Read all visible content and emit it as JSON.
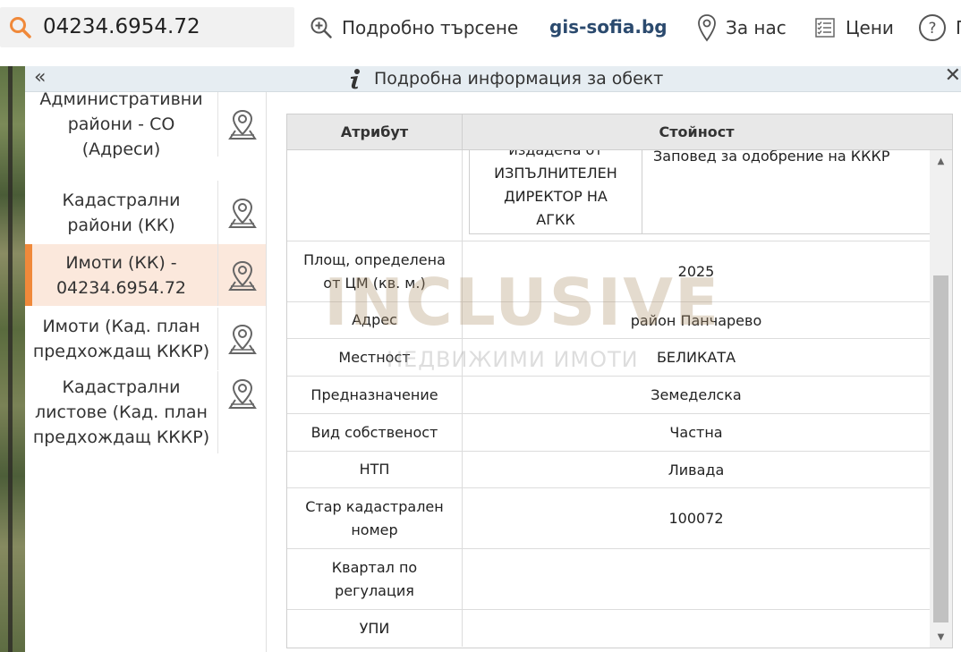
{
  "search": {
    "value": "04234.6954.72"
  },
  "nav": {
    "advanced_search": "Подробно търсене",
    "brand": "gis-sofia.bg",
    "about": "За нас",
    "prices": "Цени",
    "help": "П"
  },
  "panel": {
    "title": "Подробна информация за обект"
  },
  "layers": [
    {
      "label": "Административни\nрайони - СО\n(Адреси)"
    },
    {
      "label": "Кадастрални\nрайони (КК)"
    },
    {
      "label": "Имоти (КК) -\n04234.6954.72"
    },
    {
      "label": "Имоти (Кад. план\nпредхождащ КККР)"
    },
    {
      "label": "Кадастрални\nлистове (Кад. план\nпредхождащ КККР)"
    }
  ],
  "table": {
    "header": {
      "attribute": "Атрибут",
      "value": "Стойност"
    },
    "nested": {
      "issuer": "издадена от\nИЗПЪЛНИТЕЛЕН\nДИРЕКТОР НА\nАГКК",
      "doc": "Заповед за одобрение на КККР"
    },
    "rows": [
      {
        "attr": "Площ, определена\nот ЦМ (кв. м.)",
        "value": "2025"
      },
      {
        "attr": "Адрес",
        "value": "район Панчарево"
      },
      {
        "attr": "Местност",
        "value": "БЕЛИКАТА"
      },
      {
        "attr": "Предназначение",
        "value": "Земеделска"
      },
      {
        "attr": "Вид собственост",
        "value": "Частна"
      },
      {
        "attr": "НТП",
        "value": "Ливада"
      },
      {
        "attr": "Стар кадастрален\nномер",
        "value": "100072"
      },
      {
        "attr": "Квартал по\nрегулация",
        "value": ""
      },
      {
        "attr": "УПИ",
        "value": ""
      }
    ]
  },
  "watermark": {
    "logo": "INCLUSIVE",
    "sub": "НЕДВИЖИМИ ИМОТИ"
  },
  "colors": {
    "accent": "#f0893a",
    "brand": "#2b4a6e",
    "active_bg": "#fbe8dc"
  }
}
